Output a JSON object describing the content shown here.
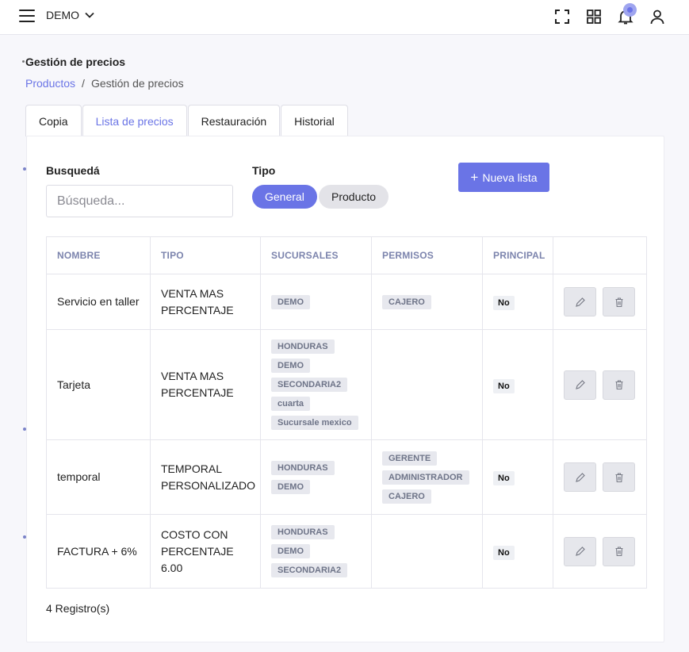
{
  "header": {
    "org": "DEMO"
  },
  "page": {
    "title": "Gestión de precios",
    "breadcrumb": {
      "link": "Productos",
      "current": "Gestión de precios",
      "separator": "/"
    }
  },
  "tabs": [
    {
      "label": "Copia",
      "active": false
    },
    {
      "label": "Lista de precios",
      "active": true
    },
    {
      "label": "Restauración",
      "active": false
    },
    {
      "label": "Historial",
      "active": false
    }
  ],
  "filters": {
    "search_label": "Busquedá",
    "search_placeholder": "Búsqueda...",
    "type_label": "Tipo",
    "type_options": [
      "General",
      "Producto"
    ],
    "type_selected": "General",
    "new_button": "Nueva lista"
  },
  "table": {
    "columns": [
      "NOMBRE",
      "TIPO",
      "SUCURSALES",
      "PERMISOS",
      "PRINCIPAL",
      ""
    ],
    "rows": [
      {
        "nombre": "Servicio en taller",
        "tipo": [
          "VENTA MAS",
          "PERCENTAJE"
        ],
        "sucursales": [
          "DEMO"
        ],
        "permisos": [
          "CAJERO"
        ],
        "principal": "No"
      },
      {
        "nombre": "Tarjeta",
        "tipo": [
          "VENTA MAS",
          "PERCENTAJE"
        ],
        "sucursales": [
          "HONDURAS",
          "DEMO",
          "SECONDARIA2",
          "cuarta",
          "Sucursale mexico"
        ],
        "permisos": [],
        "principal": "No"
      },
      {
        "nombre": "temporal",
        "tipo": [
          "TEMPORAL",
          "PERSONALIZADO"
        ],
        "sucursales": [
          "HONDURAS",
          "DEMO"
        ],
        "permisos": [
          "GERENTE",
          "ADMINISTRADOR",
          "CAJERO"
        ],
        "principal": "No"
      },
      {
        "nombre": "FACTURA + 6%",
        "tipo": [
          "COSTO CON",
          "PERCENTAJE",
          "6.00"
        ],
        "sucursales": [
          "HONDURAS",
          "DEMO",
          "SECONDARIA2"
        ],
        "permisos": [],
        "principal": "No"
      }
    ]
  },
  "footer": {
    "count": "4 Registro(s)"
  }
}
